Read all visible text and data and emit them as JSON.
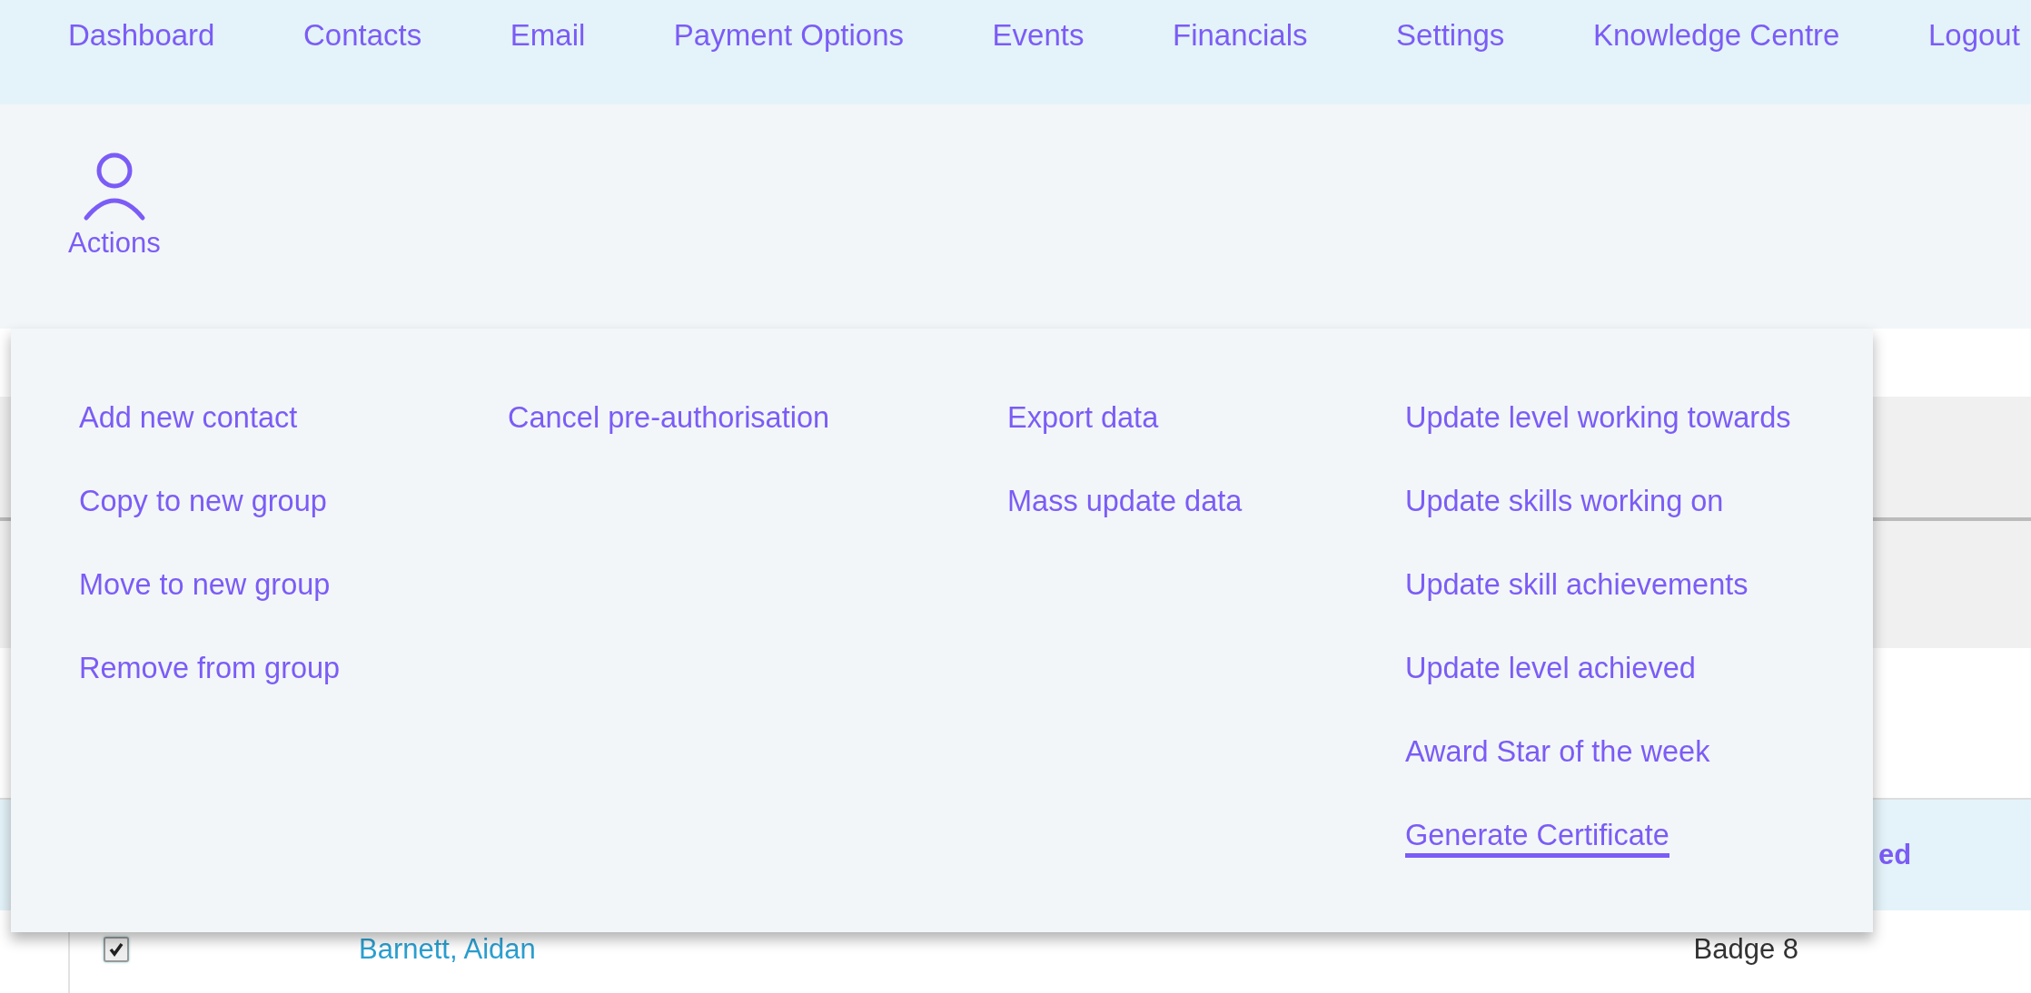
{
  "nav": [
    {
      "label": "Dashboard"
    },
    {
      "label": "Contacts"
    },
    {
      "label": "Email"
    },
    {
      "label": "Payment Options"
    },
    {
      "label": "Events"
    },
    {
      "label": "Financials"
    },
    {
      "label": "Settings"
    },
    {
      "label": "Knowledge Centre"
    },
    {
      "label": "Logout"
    }
  ],
  "toolbar": {
    "label": "Actions"
  },
  "actions_menu": {
    "columns": [
      [
        {
          "label": "Add new contact",
          "selected": false
        },
        {
          "label": "Copy to new group",
          "selected": false
        },
        {
          "label": "Move to new group",
          "selected": false
        },
        {
          "label": "Remove from group",
          "selected": false
        }
      ],
      [
        {
          "label": "Cancel pre-authorisation",
          "selected": false
        }
      ],
      [
        {
          "label": "Export data",
          "selected": false
        },
        {
          "label": "Mass update data",
          "selected": false
        }
      ],
      [
        {
          "label": "Update level working towards",
          "selected": false
        },
        {
          "label": "Update skills working on",
          "selected": false
        },
        {
          "label": "Update skill achievements",
          "selected": false
        },
        {
          "label": "Update level achieved",
          "selected": false
        },
        {
          "label": "Award Star of the week",
          "selected": false
        },
        {
          "label": "Generate Certificate",
          "selected": true
        }
      ]
    ]
  },
  "table": {
    "header_text": "ed",
    "rows": [
      {
        "checked": true,
        "name": "Barnett, Aidan",
        "column_3": "Badge 8"
      }
    ]
  }
}
